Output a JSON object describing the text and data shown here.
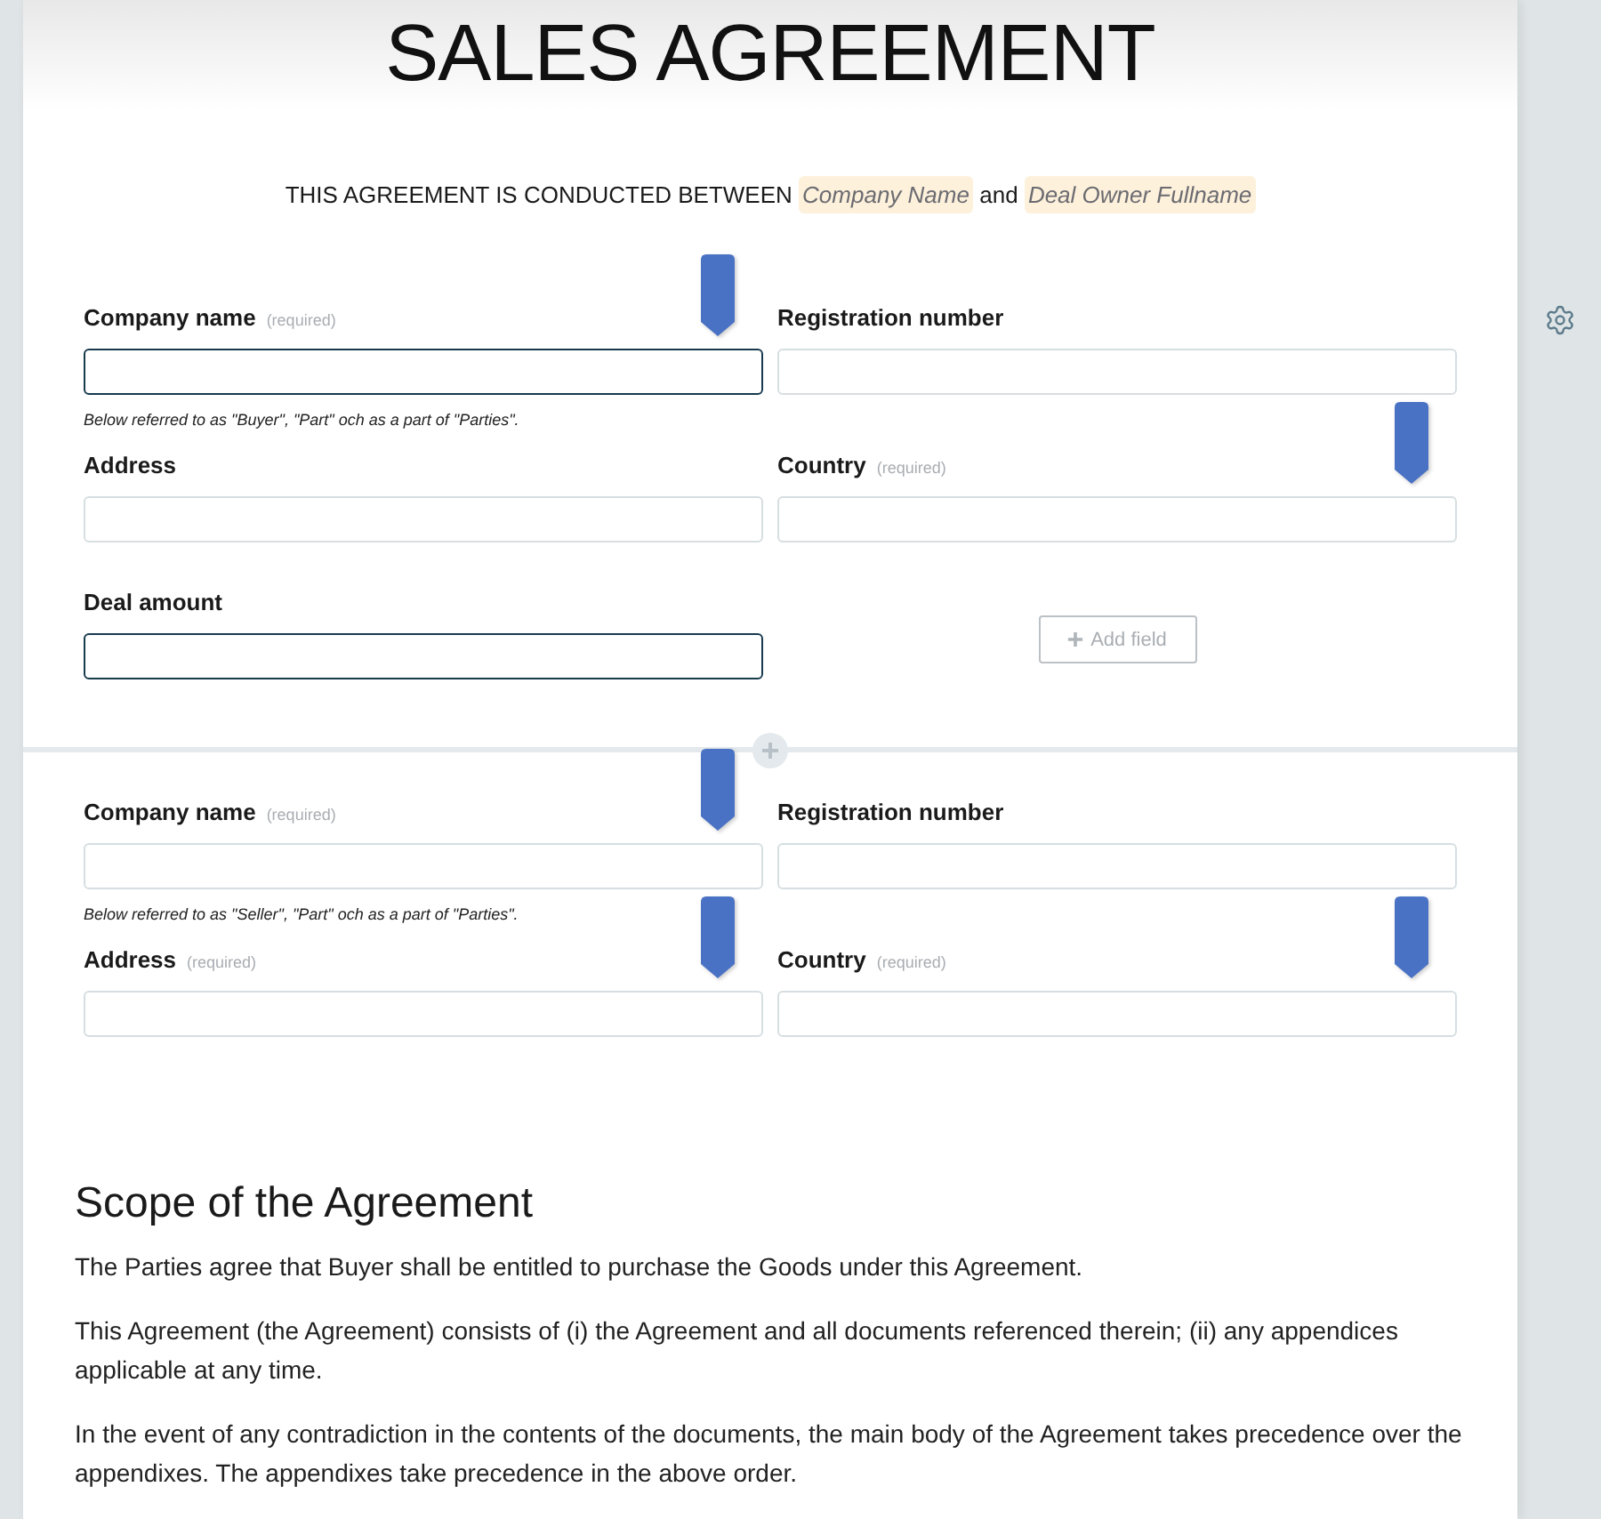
{
  "document": {
    "title": "SALES AGREEMENT",
    "intro": [
      {
        "kind": "text",
        "text": "THIS AGREEMENT IS CONDUCTED BETWEEN"
      },
      {
        "kind": "variable",
        "text": "Company Name"
      },
      {
        "kind": "text",
        "text": "and"
      },
      {
        "kind": "variable",
        "text": "Deal Owner Fullname"
      }
    ]
  },
  "sections": [
    {
      "fields": [
        {
          "label": "Company name",
          "required_label": "(required)",
          "note": "Below referred to as \"Buyer\", \"Part\" och as a part of \"Parties\".",
          "highlighted": true,
          "bookmarked": true
        },
        {
          "label": "Registration number",
          "highlighted": false,
          "bookmarked": false
        },
        {
          "label": "Address",
          "highlighted": false,
          "bookmarked": false
        },
        {
          "label": "Country",
          "required_label": "(required)",
          "highlighted": false,
          "bookmarked": true
        },
        {
          "label": "Deal amount",
          "highlighted": true,
          "bookmarked": false
        }
      ],
      "add_field_button": "Add field"
    },
    {
      "fields": [
        {
          "label": "Company name",
          "required_label": "(required)",
          "note": "Below referred to as \"Seller\", \"Part\" och as a part of \"Parties\".",
          "highlighted": false,
          "bookmarked": true
        },
        {
          "label": "Registration number",
          "highlighted": false,
          "bookmarked": false
        },
        {
          "label": "Address",
          "required_label": "(required)",
          "highlighted": false,
          "bookmarked": true
        },
        {
          "label": "Country",
          "required_label": "(required)",
          "highlighted": false,
          "bookmarked": true
        }
      ]
    }
  ],
  "scope": {
    "heading": "Scope of the Agreement",
    "paragraphs": [
      "The Parties agree that Buyer shall be entitled to purchase the Goods under this Agreement.",
      "This Agreement (the Agreement) consists of (i) the Agreement and all documents referenced therein; (ii) any appendices applicable at any time.",
      "In the event of any contradiction in the contents of the documents, the main body of the Agreement takes precedence over the appendixes. The appendixes take precedence in the above order."
    ]
  }
}
